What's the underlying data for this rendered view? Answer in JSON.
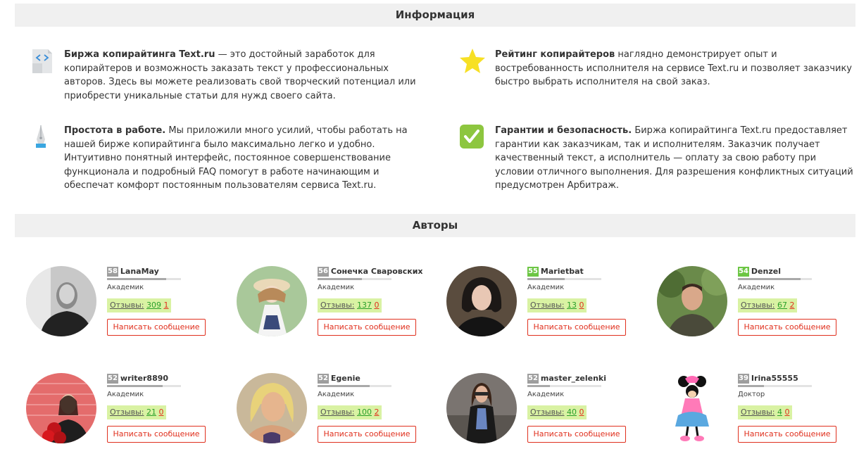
{
  "info": {
    "title": "Информация",
    "items": [
      {
        "icon": "code-document-icon",
        "bold": "Биржа копирайтинга Text.ru",
        "text": " — это достойный заработок для копирайтеров и возможность заказать текст у профессиональных авторов. Здесь вы можете реализовать свой творческий потенциал или приобрести уникальные статьи для нужд своего сайта."
      },
      {
        "icon": "star-icon",
        "bold": "Рейтинг копирайтеров",
        "text": " наглядно демонстрирует опыт и востребованность исполнителя на сервисе Text.ru и позволяет заказчику быстро выбрать исполнителя на свой заказ."
      },
      {
        "icon": "pen-nib-icon",
        "bold": "Простота в работе.",
        "text": " Мы приложили много усилий, чтобы работать на нашей бирже копирайтинга было максимально легко и удобно. Интуитивно понятный интерфейс, постоянное совершенствование функционала и подробный FAQ помогут в работе начинающим и обеспечат комфорт постоянным пользователям сервиса Text.ru."
      },
      {
        "icon": "checkmark-icon",
        "bold": "Гарантии и безопасность.",
        "text": " Биржа копирайтинга Text.ru предоставляет гарантии как заказчикам, так и исполнителям. Заказчик получает качественный текст, а исполнитель — оплату за свою работу при условии отличного выполнения. Для разрешения конфликтных ситуаций предусмотрен Арбитраж."
      }
    ]
  },
  "authors": {
    "title": "Авторы",
    "reviews_label": "Отзывы:",
    "message_label": "Написать сообщение",
    "list": [
      {
        "level": "58",
        "level_color": "#9e9e9e",
        "name": "LanaMay",
        "status": "Академик",
        "positive": "309",
        "negative": "1",
        "progress": 0.8
      },
      {
        "level": "56",
        "level_color": "#9e9e9e",
        "name": "Сонечка Сваровских",
        "status": "Академик",
        "positive": "137",
        "negative": "0",
        "progress": 0.6
      },
      {
        "level": "55",
        "level_color": "#6cc644",
        "name": "Marietbat",
        "status": "Академик",
        "positive": "13",
        "negative": "0",
        "progress": 0.5
      },
      {
        "level": "54",
        "level_color": "#6cc644",
        "name": "Denzel",
        "status": "Академик",
        "positive": "67",
        "negative": "2",
        "progress": 0.85
      },
      {
        "level": "52",
        "level_color": "#9e9e9e",
        "name": "writer8890",
        "status": "Академик",
        "positive": "21",
        "negative": "0",
        "progress": 0.75
      },
      {
        "level": "52",
        "level_color": "#9e9e9e",
        "name": "Egenie",
        "status": "Академик",
        "positive": "100",
        "negative": "2",
        "progress": 0.7
      },
      {
        "level": "52",
        "level_color": "#9e9e9e",
        "name": "master_zelenki",
        "status": "Академик",
        "positive": "40",
        "negative": "0",
        "progress": 0.3
      },
      {
        "level": "39",
        "level_color": "#9e9e9e",
        "name": "Irina55555",
        "status": "Доктор",
        "positive": "4",
        "negative": "0",
        "progress": 0.35
      }
    ]
  }
}
